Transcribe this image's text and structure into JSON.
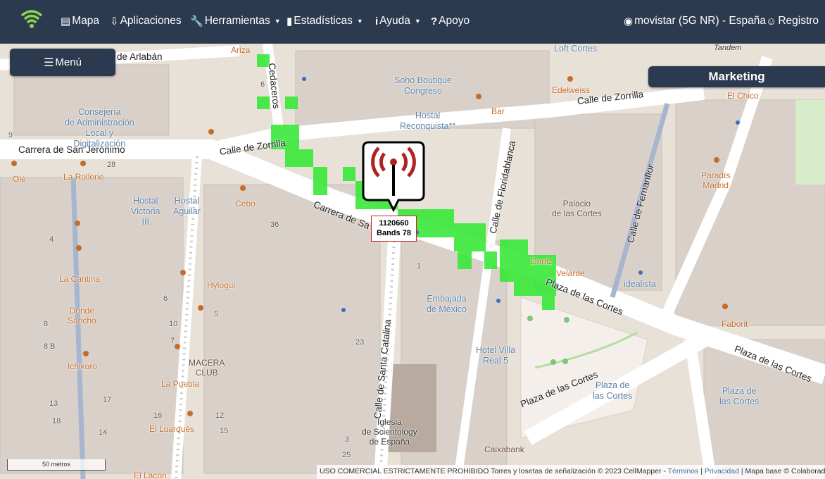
{
  "navbar": {
    "logo": "cellmapper-signal-icon",
    "items": {
      "map": {
        "label": "Mapa",
        "icon": "map-icon"
      },
      "apps": {
        "label": "Aplicaciones",
        "icon": "download-icon"
      },
      "tools": {
        "label": "Herramientas",
        "icon": "wrench-icon"
      },
      "stats": {
        "label": "Estadísticas",
        "icon": "signal-bars-icon"
      },
      "help": {
        "label": "Ayuda",
        "icon": "info-icon"
      },
      "support": {
        "label": "Apoyo",
        "icon": "question-icon"
      }
    },
    "network": {
      "label": "movistar (5G NR) - España",
      "icon": "map-marker-icon"
    },
    "register": {
      "label": "Registro",
      "icon": "user-plus-icon"
    },
    "colors": {
      "background": "#2b3a4e",
      "text": "#ffffff"
    }
  },
  "menu_button": {
    "label": "Menú",
    "icon": "hamburger-icon"
  },
  "marketing_button": {
    "label": "Marketing"
  },
  "tower": {
    "id": "1120660",
    "bands": "Bands 78",
    "icon": "cell-tower-icon",
    "colors": {
      "ring": "#b22222",
      "coverage": "#39e83a"
    }
  },
  "scale": {
    "label": "50 metros"
  },
  "attribution": {
    "prefix": "USO COMERCIAL ESTRICTAMENTE PROHIBIDO Torres y losetas de señalización © 2023 CellMapper - ",
    "terms": "Términos",
    "sep1": " | ",
    "privacy": "Privacidad",
    "sep2": " | Mapa base © Colaboradores"
  },
  "map": {
    "streets": {
      "arlaban": "de Arlabán",
      "zorrilla_east": "Calle de Zorrilla",
      "zorrilla_west": "Calle de Zorrilla",
      "san_jeronimo": "Carrera de San Jerónimo",
      "carrera_sa": "Carrera de Sa",
      "cortes_main": "Plaza de las Cortes",
      "cortes_south": "Plaza de las Cortes",
      "cortes_east": "Plaza de las Cortes",
      "floridablanca": "Calle de Floridablanca",
      "fernanflor": "Calle de Fernanflor",
      "santa_catalina": "Calle de Santa Catalina",
      "cedaceros": "Cedaceros"
    },
    "pois": {
      "arriza": "Ariza",
      "loft": "Loft Cortes",
      "tandem": "Tandem",
      "soho": "Soho Boutique\nCongreso",
      "edelweiss": "Edelweiss",
      "el_chico": "El Chico",
      "hostal_reconquista": "Hostal\nReconquista**",
      "bar": "Bar",
      "consejeria": "Consejería\nde Administración\nLocal y\nDigitalización",
      "ole": "Olé",
      "rollerie": "La Rollerie",
      "hostal_victoria": "Hostal\nVictoria\nIII",
      "hostal_aguilar": "Hostal\nAguilar",
      "cebo": "Cebo",
      "palacio": "Palacio\nde las Cortes",
      "paradis": "Paradís\nMadrid",
      "daola": "Daolz",
      "velarde": "Velarde",
      "idealista": "idealista",
      "embajada": "Embajada\nde México",
      "la_cantina": "La Cantina",
      "donde_sancho": "Donde\nSancho",
      "hylogui": "Hylogui",
      "hotel_villa": "Hotel Villa\nReal 5",
      "faborit": "Faborit",
      "ichikoro": "Ichikoro",
      "macera": "MACERA\nCLUB",
      "la_puebla": "La Puebla",
      "el_luarques": "El Luarqués",
      "iglesia": "Iglesia\nde Scientology\nde España",
      "caixabank": "Caixabank",
      "plaza_cortes_poi": "Plaza de\nlas Cortes",
      "plaza_cortes_poi2": "Plaza de\nlas Cortes",
      "el_lacon": "El Lacón"
    },
    "numbers": [
      "9",
      "28",
      "36",
      "1",
      "4",
      "6",
      "5",
      "8",
      "10",
      "8 B",
      "7",
      "18",
      "16",
      "12",
      "13",
      "14",
      "17",
      "15",
      "3",
      "25",
      "23",
      "6",
      "10",
      "9"
    ]
  }
}
